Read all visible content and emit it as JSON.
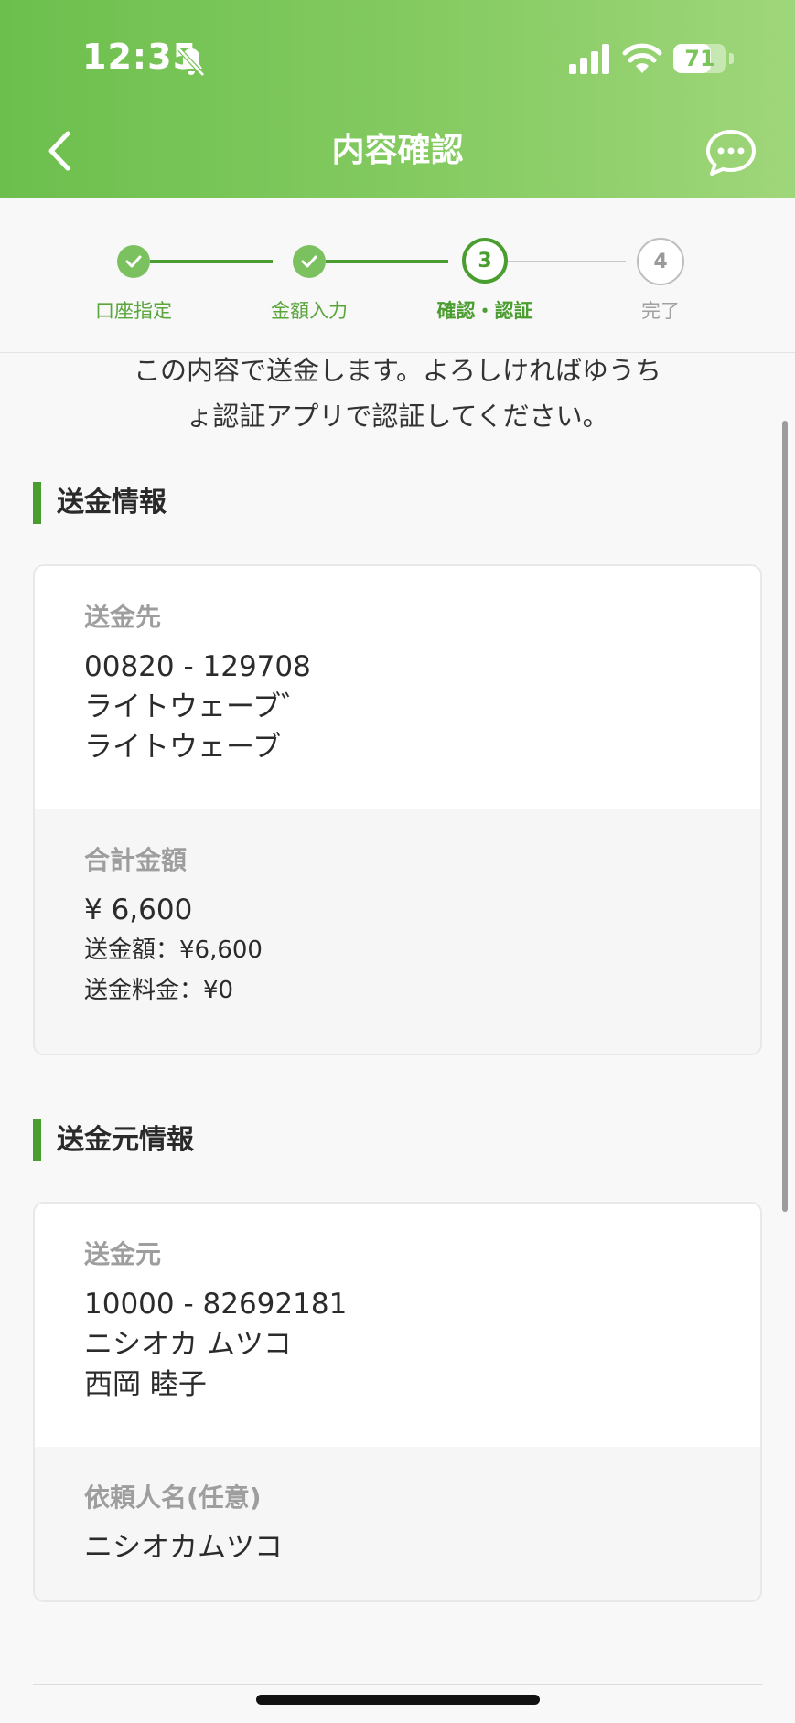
{
  "status_bar": {
    "time": "12:35",
    "battery_percent": 71,
    "battery_label": "71"
  },
  "nav": {
    "title": "内容確認",
    "back_icon": "chevron-left-icon",
    "chat_icon": "chat-bubble-icon"
  },
  "stepper": {
    "steps": [
      {
        "number": "1",
        "label": "口座指定",
        "state": "done"
      },
      {
        "number": "2",
        "label": "金額入力",
        "state": "done"
      },
      {
        "number": "3",
        "label": "確認・認証",
        "state": "current"
      },
      {
        "number": "4",
        "label": "完了",
        "state": "todo"
      }
    ]
  },
  "intro": {
    "line1": "この内容で送金します。よろしければゆうち",
    "line2": "ょ認証アプリで認証してください。"
  },
  "transfer_section": {
    "title": "送金情報",
    "recipient": {
      "label": "送金先",
      "account": "00820 - 129708",
      "name_kana": "ライトウェーブ゛",
      "name": "ライトウェーブ"
    },
    "total": {
      "label": "合計金額",
      "amount": "¥ 6,600",
      "transfer_amount": "送金額：¥6,600",
      "fee": "送金料金：¥0"
    }
  },
  "sender_section": {
    "title": "送金元情報",
    "sender": {
      "label": "送金元",
      "account": "10000 - 82692181",
      "name_kana": "ニシオカ ムツコ",
      "name": "西岡 睦子"
    },
    "requester": {
      "label": "依頼人名(任意)",
      "value": "ニシオカムツコ"
    }
  },
  "colors": {
    "brand_green": "#4a9d2f",
    "header_green": "#7cc55a",
    "muted_label": "#9e9e9e"
  }
}
